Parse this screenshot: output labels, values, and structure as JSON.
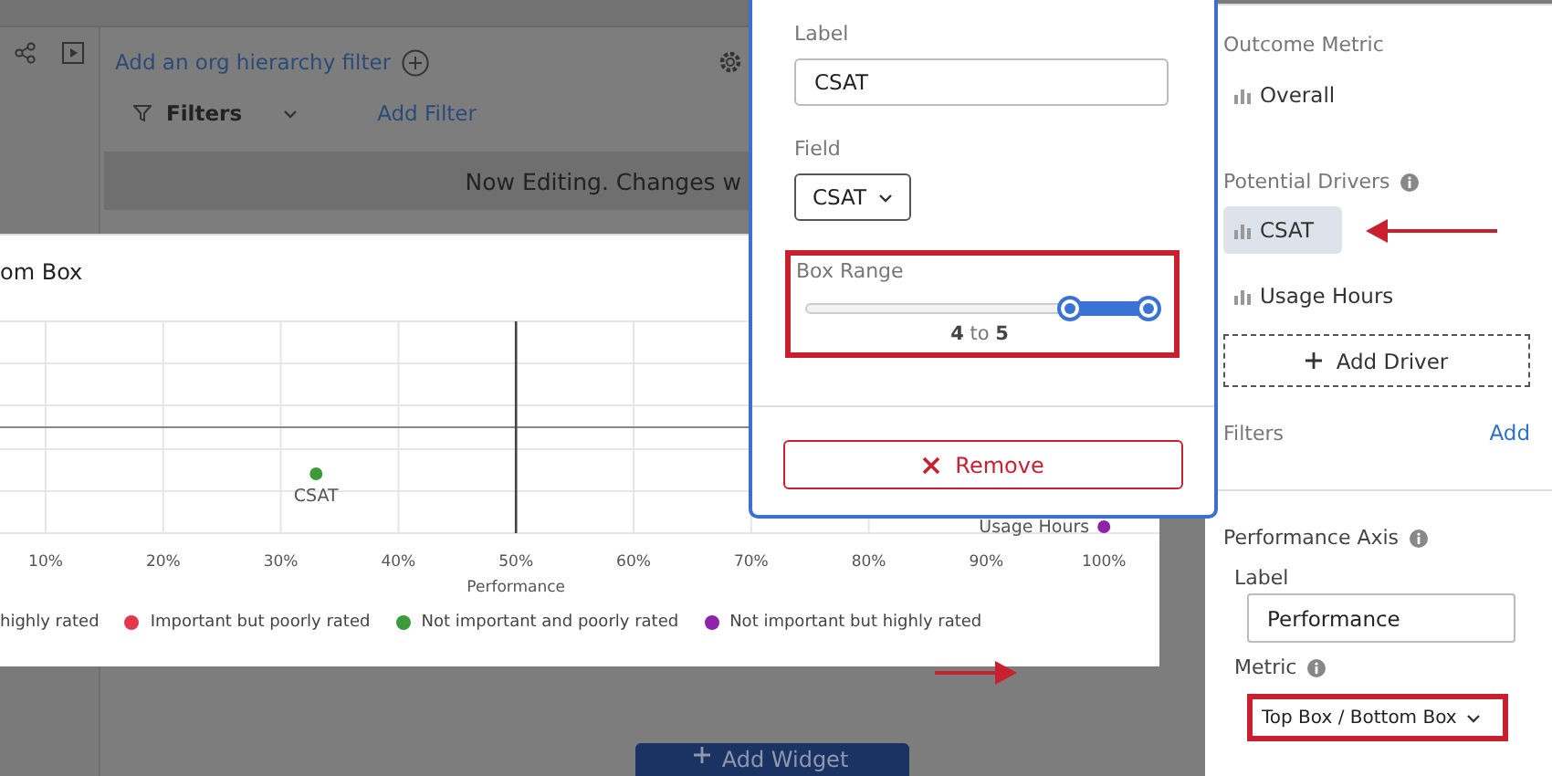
{
  "header": {
    "org_filter_link": "Add an org hierarchy filter",
    "filters_label": "Filters",
    "add_filter_link": "Add Filter"
  },
  "notice": "Now Editing. Changes w",
  "widget": {
    "title": "om Box",
    "plot": {
      "x_ticks": [
        "10%",
        "20%",
        "30%",
        "40%",
        "50%",
        "60%",
        "70%",
        "80%",
        "90%",
        "100%"
      ],
      "x_axis_title": "Performance",
      "points": [
        {
          "label": "CSAT",
          "color": "#3b9b3b"
        },
        {
          "label": "Usage Hours",
          "color": "#8e24aa"
        }
      ]
    },
    "legend": [
      {
        "label": "highly rated"
      },
      {
        "label": "Important but poorly rated",
        "color": "#e2384d"
      },
      {
        "label": "Not important and poorly rated",
        "color": "#3b9b3b"
      },
      {
        "label": "Not important but highly rated",
        "color": "#8e24aa"
      }
    ]
  },
  "add_widget_button": "Add Widget",
  "popover": {
    "label_caption": "Label",
    "label_value": "CSAT",
    "field_caption": "Field",
    "field_value": "CSAT",
    "box_range": {
      "caption": "Box Range",
      "level": 0.23,
      "reading": "**4** to **5**",
      "highlighted": true
    },
    "remove_button": "Remove"
  },
  "side_panel": {
    "outcome_caption": "Outcome Metric",
    "outcome": "Overall",
    "drivers_caption": "Potential Drivers",
    "drivers": [
      {
        "label": "CSAT",
        "selected": true
      },
      {
        "label": "Usage Hours",
        "selected": false
      }
    ],
    "add_driver": "Add Driver",
    "filters_caption": "Filters",
    "filters_add": "Add",
    "axis_caption": "Performance Axis",
    "axis_label_caption": "Label",
    "axis_label_value": "Performance",
    "metric_caption": "Metric",
    "metric_value": "Top Box / Bottom Box",
    "metric_highlighted": true
  }
}
